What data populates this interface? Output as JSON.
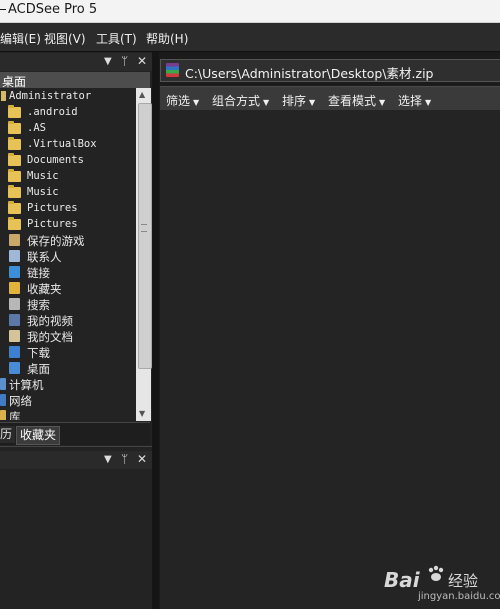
{
  "window": {
    "title": "ACDSee Pro 5"
  },
  "menu": {
    "items": [
      "编辑(E)",
      "视图(V)",
      "工具(T)",
      "帮助(H)"
    ]
  },
  "pane_controls": {
    "dropdown": "▼",
    "pin": "ᛘ",
    "close": "✕"
  },
  "folders": {
    "header": "桌面",
    "items": [
      {
        "label": "Administrator",
        "icon": "user-folder-icon"
      },
      {
        "label": ".android",
        "icon": "folder-icon"
      },
      {
        "label": ".AS",
        "icon": "folder-icon"
      },
      {
        "label": ".VirtualBox",
        "icon": "folder-icon"
      },
      {
        "label": "Documents",
        "icon": "folder-icon"
      },
      {
        "label": "Music",
        "icon": "folder-icon"
      },
      {
        "label": "Music",
        "icon": "folder-icon"
      },
      {
        "label": "Pictures",
        "icon": "folder-icon"
      },
      {
        "label": "Pictures",
        "icon": "folder-icon"
      },
      {
        "label": "保存的游戏",
        "icon": "saved-games-icon"
      },
      {
        "label": "联系人",
        "icon": "contacts-icon"
      },
      {
        "label": "链接",
        "icon": "links-icon"
      },
      {
        "label": "收藏夹",
        "icon": "favorites-icon"
      },
      {
        "label": "搜索",
        "icon": "search-folder-icon"
      },
      {
        "label": "我的视频",
        "icon": "videos-icon"
      },
      {
        "label": "我的文档",
        "icon": "documents-icon"
      },
      {
        "label": "下载",
        "icon": "downloads-icon"
      },
      {
        "label": "桌面",
        "icon": "desktop-icon"
      },
      {
        "label": "计算机",
        "icon": "computer-icon"
      },
      {
        "label": "网络",
        "icon": "network-icon"
      },
      {
        "label": "库",
        "icon": "library-icon"
      }
    ]
  },
  "tabs": [
    "历",
    "收藏夹"
  ],
  "address": {
    "path": "C:\\Users\\Administrator\\Desktop\\素材.zip"
  },
  "toolbar": {
    "items": [
      "筛选",
      "组合方式",
      "排序",
      "查看模式",
      "选择"
    ]
  },
  "watermark": {
    "brand": "Bai",
    "brand_cn": "经验",
    "url": "jingyan.baidu.com"
  }
}
